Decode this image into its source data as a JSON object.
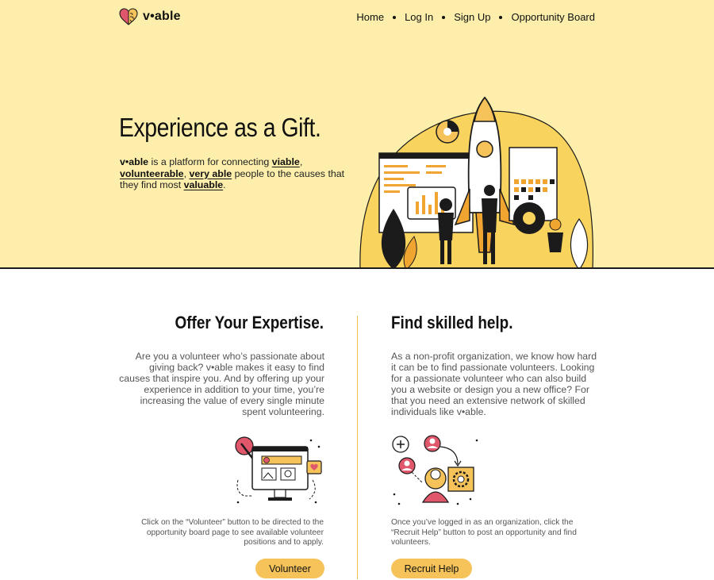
{
  "header": {
    "logo_text": "v•able",
    "nav": [
      {
        "label": "Home"
      },
      {
        "label": "Log In"
      },
      {
        "label": "Sign Up"
      },
      {
        "label": "Opportunity Board"
      }
    ]
  },
  "hero": {
    "title": "Experience as a Gift.",
    "desc_brand": "v•able",
    "desc_part1": " is a platform for connecting ",
    "link_viable": "viable",
    "desc_part2": ", ",
    "link_volunteerable": "volunteerable",
    "desc_part3": ", ",
    "link_very_able": "very able",
    "desc_part4": " people to the causes that they find most ",
    "link_valuable": "valuable",
    "desc_part5": "."
  },
  "volunteer": {
    "title": "Offer Your Expertise.",
    "text": "Are you a volunteer who’s passionate about giving back? v•able makes it easy to find causes that inspire you. And by offering up your experience in addition to your time, you’re increasing the value of every single minute spent volunteering.",
    "note": "Click on the “Volunteer” button to be directed to the opportunity board page to see available volunteer positions and to apply.",
    "button": "Volunteer"
  },
  "organization": {
    "title": "Find skilled help.",
    "text": "As a non-profit organization, we know how hard it can be to find passionate volunteers. Looking for a passionate volunteer who can also build you a website or design you a new office? For that you need an extensive network of skilled individuals like v•able.",
    "note": "Once you’ve logged in as an organization, click the “Recruit Help” button to post an opportunity and find volunteers.",
    "button": "Recruit Help"
  },
  "icons": {
    "logo": "heart-brain-icon",
    "hero": "rocket-team-illustration",
    "volunteer": "computer-volunteer-illustration",
    "organization": "network-people-illustration"
  },
  "colors": {
    "hero_bg": "#fdefab",
    "accent": "#f5c35a",
    "heart": "#e0566b",
    "divider": "#f0c24c"
  }
}
